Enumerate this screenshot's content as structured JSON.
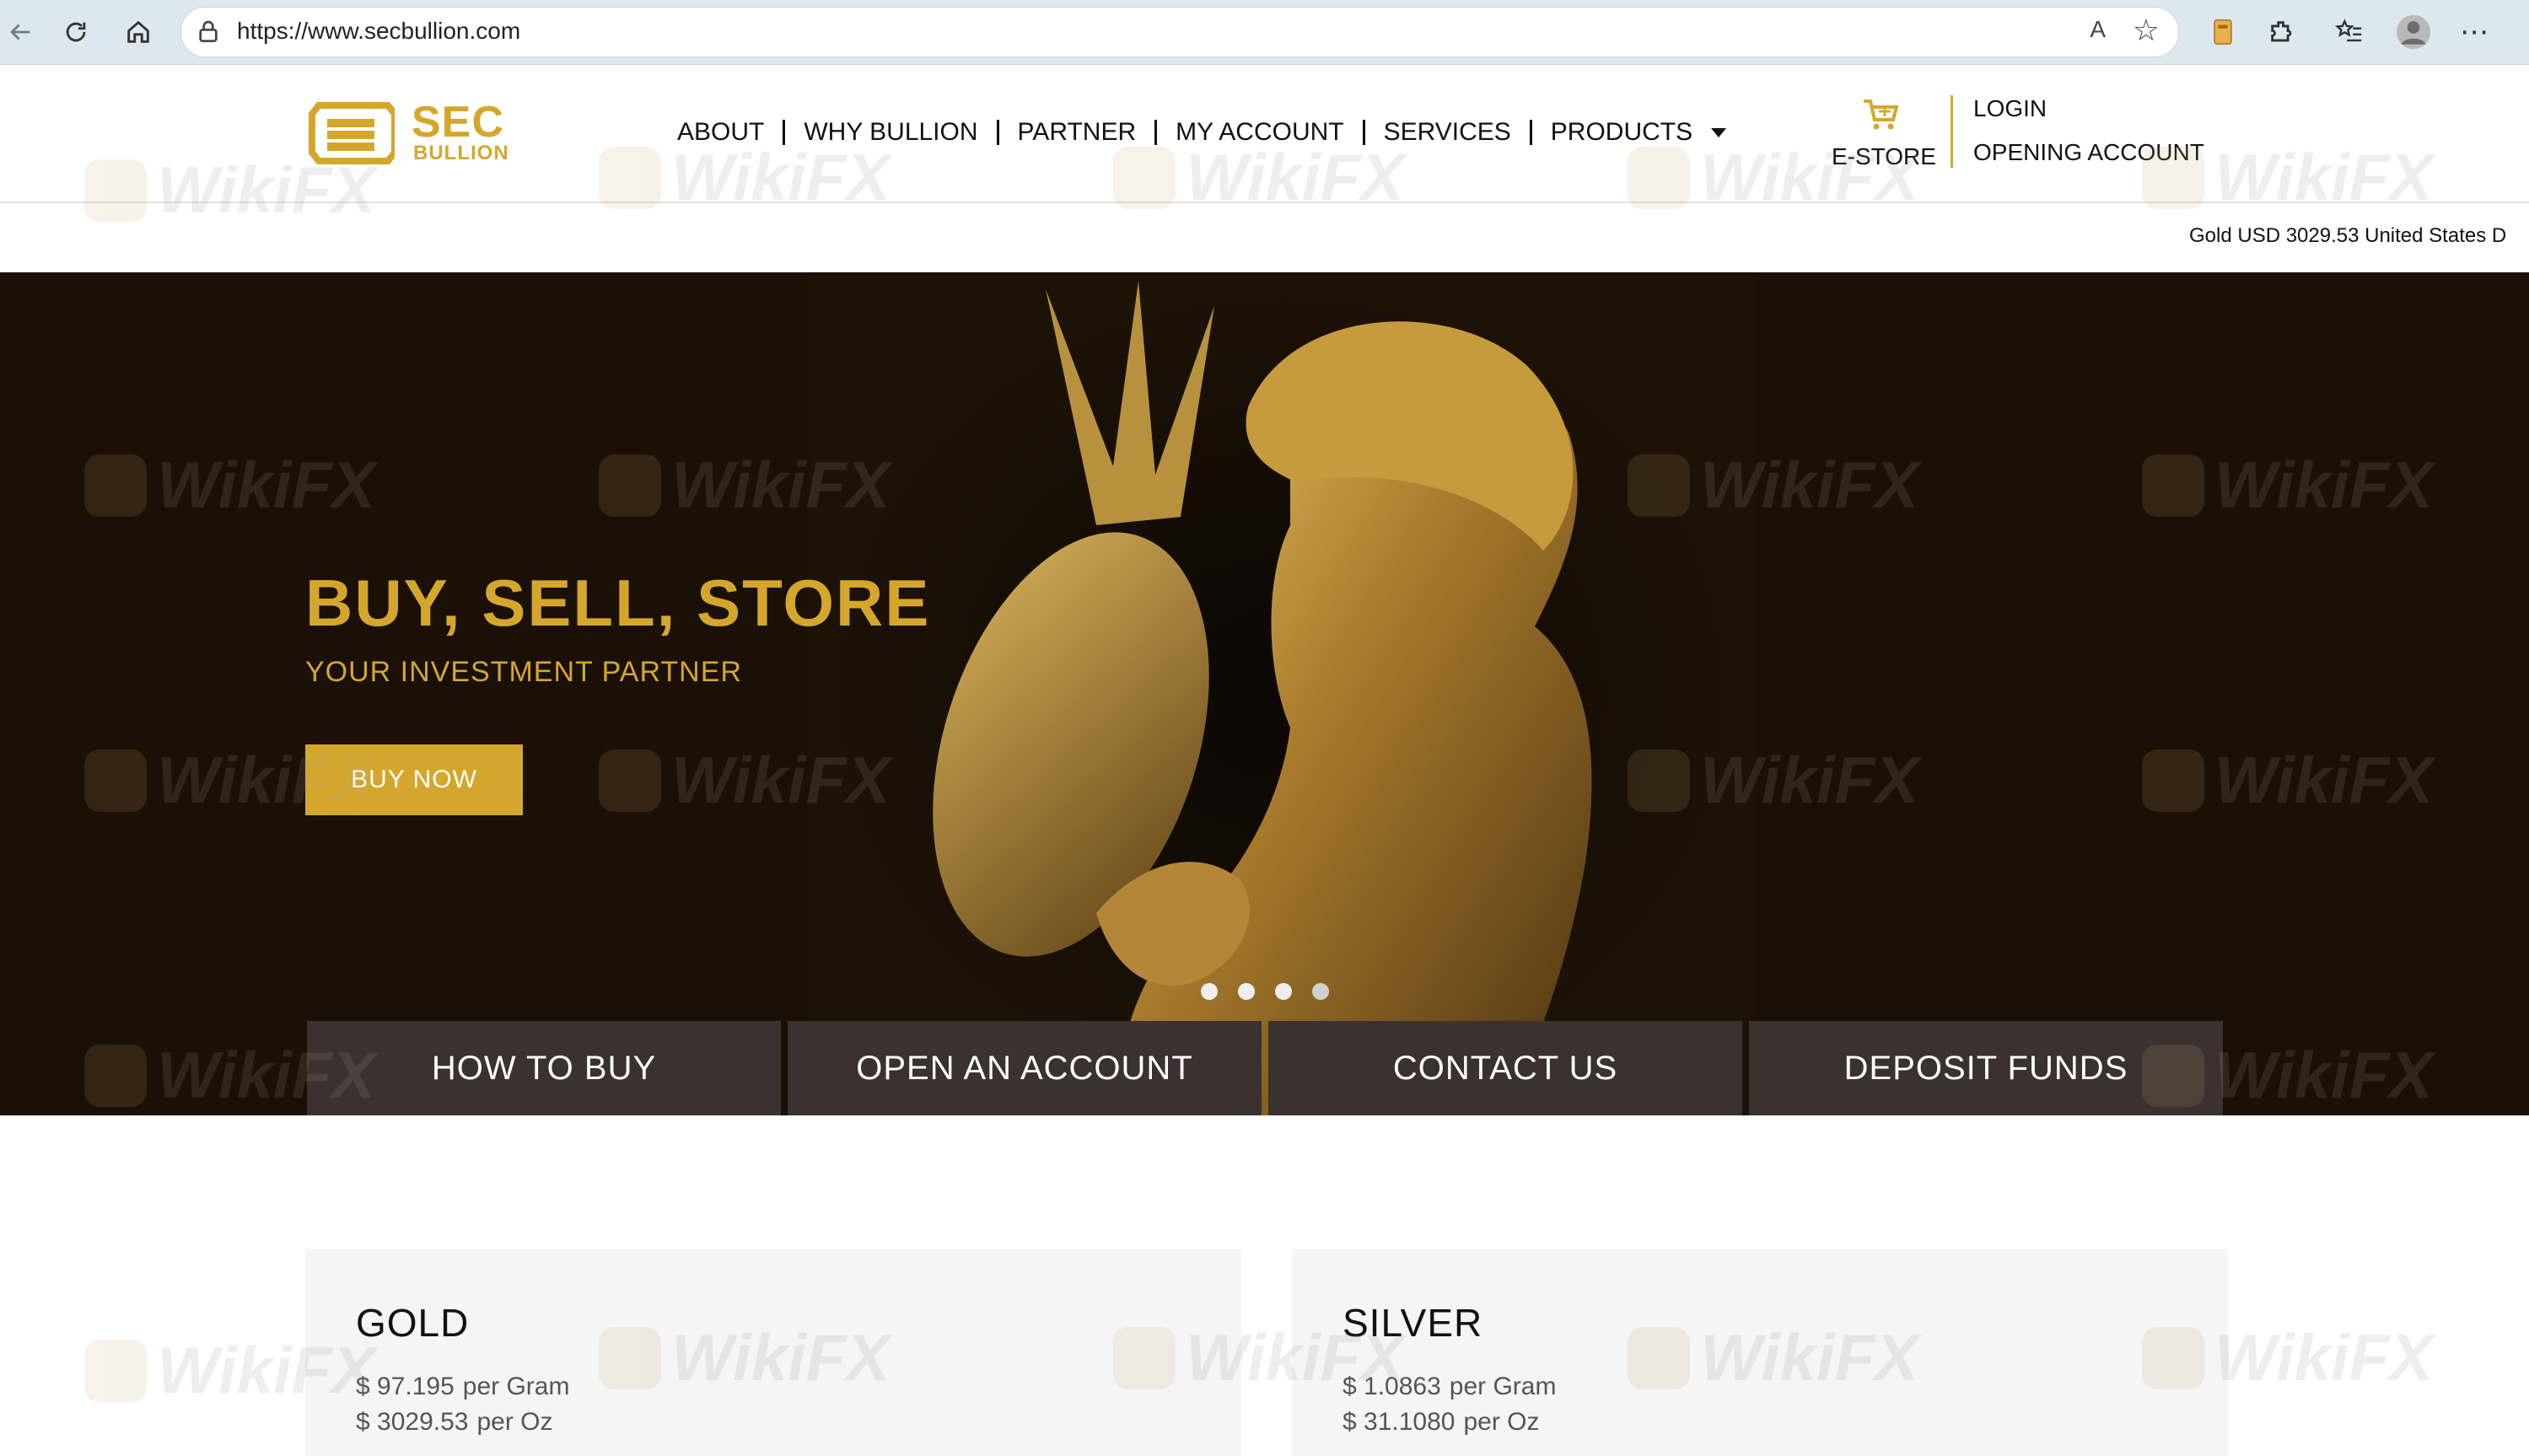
{
  "browser": {
    "url": "https://www.secbullion.com",
    "read_aloud_label": "A",
    "icons": [
      "back-icon",
      "reload-icon",
      "home-icon",
      "lock-icon",
      "read-aloud-icon",
      "favorite-star-icon",
      "extension-icon",
      "puzzle-icon",
      "favorites-icon",
      "profile-avatar",
      "more-icon"
    ]
  },
  "logo": {
    "line1": "SEC",
    "line2": "BULLION"
  },
  "nav": {
    "items": [
      {
        "label": "ABOUT"
      },
      {
        "label": "WHY BULLION"
      },
      {
        "label": "PARTNER"
      },
      {
        "label": "MY ACCOUNT"
      },
      {
        "label": "SERVICES"
      },
      {
        "label": "PRODUCTS"
      }
    ]
  },
  "header": {
    "estore_label": "E-STORE",
    "login_label": "LOGIN",
    "opening_account_label": "OPENING ACCOUNT"
  },
  "ticker": {
    "text": "Gold USD 3029.53 United States D"
  },
  "hero": {
    "title": "BUY, SELL, STORE",
    "subtitle": "YOUR INVESTMENT PARTNER",
    "cta_label": "BUY NOW",
    "slides_count": 4,
    "active_slide": 1
  },
  "actions": [
    {
      "label": "HOW TO BUY"
    },
    {
      "label": "OPEN AN ACCOUNT"
    },
    {
      "label": "CONTACT US"
    },
    {
      "label": "DEPOSIT FUNDS"
    }
  ],
  "prices": {
    "gold": {
      "name": "GOLD",
      "gram_value": "$ 97.195",
      "gram_unit": "per Gram",
      "oz_value": "$ 3029.53",
      "oz_unit": "per Oz"
    },
    "silver": {
      "name": "SILVER",
      "gram_value": "$ 1.0863",
      "gram_unit": "per Gram",
      "oz_value": "$ 31.1080",
      "oz_unit": "per Oz"
    }
  },
  "watermark": {
    "text": "WikiFX"
  },
  "colors": {
    "brand_gold": "#d4a72c",
    "hero_bg": "#1a0f05",
    "action_bg": "#3b3230",
    "card_bg": "#f5f5f5"
  }
}
